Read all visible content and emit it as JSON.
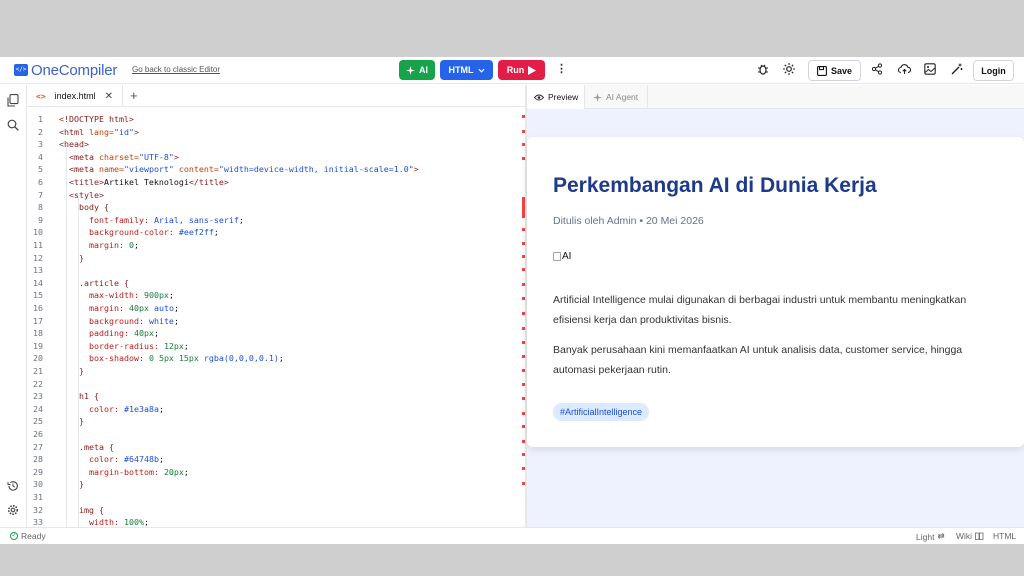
{
  "header": {
    "logo_text": "OneCompiler",
    "logo_mark": "</>",
    "back_link": "Go back to classic Editor",
    "ai_label": "AI",
    "lang_label": "HTML",
    "run_label": "Run",
    "save_label": "Save",
    "login_label": "Login",
    "icons": [
      "bug-icon",
      "sun-icon",
      "save-icon",
      "share-icon",
      "upload-icon",
      "image-icon",
      "magic-icon"
    ]
  },
  "editor": {
    "tab_name": "index.html",
    "lines": [
      {
        "n": "1",
        "i": 0,
        "t": [
          [
            "c-tag",
            "<!DOCTYPE html>"
          ]
        ]
      },
      {
        "n": "2",
        "i": 0,
        "t": [
          [
            "c-tag",
            "<html "
          ],
          [
            "c-attr",
            "lang="
          ],
          [
            "c-val",
            "\"id\""
          ],
          [
            "c-tag",
            ">"
          ]
        ]
      },
      {
        "n": "3",
        "i": 0,
        "t": [
          [
            "c-tag",
            "<head>"
          ]
        ]
      },
      {
        "n": "4",
        "i": 1,
        "t": [
          [
            "c-tag",
            "<meta "
          ],
          [
            "c-attr",
            "charset="
          ],
          [
            "c-val",
            "\"UTF-8\""
          ],
          [
            "c-tag",
            ">"
          ]
        ]
      },
      {
        "n": "5",
        "i": 1,
        "t": [
          [
            "c-tag",
            "<meta "
          ],
          [
            "c-attr",
            "name="
          ],
          [
            "c-val",
            "\"viewport\" "
          ],
          [
            "c-attr",
            "content="
          ],
          [
            "c-val",
            "\"width=device-width, initial-scale=1.0\""
          ],
          [
            "c-tag",
            ">"
          ]
        ]
      },
      {
        "n": "6",
        "i": 1,
        "t": [
          [
            "c-tag",
            "<title>"
          ],
          [
            "",
            "Artikel Teknologi"
          ],
          [
            "c-tag",
            "</title>"
          ]
        ]
      },
      {
        "n": "7",
        "i": 1,
        "t": [
          [
            "c-tag",
            "<style>"
          ]
        ]
      },
      {
        "n": "8",
        "i": 2,
        "t": [
          [
            "c-sel",
            "body {"
          ]
        ]
      },
      {
        "n": "9",
        "i": 3,
        "t": [
          [
            "c-prop",
            "font-family: "
          ],
          [
            "c-val",
            "Arial, sans-serif"
          ],
          [
            "",
            ";"
          ]
        ]
      },
      {
        "n": "10",
        "i": 3,
        "t": [
          [
            "c-prop",
            "background-color: "
          ],
          [
            "c-val",
            "#eef2ff"
          ],
          [
            "",
            ";"
          ]
        ]
      },
      {
        "n": "11",
        "i": 3,
        "t": [
          [
            "c-prop",
            "margin: "
          ],
          [
            "c-num",
            "0"
          ],
          [
            "",
            ";"
          ]
        ]
      },
      {
        "n": "12",
        "i": 2,
        "t": [
          [
            "c-sel",
            "}"
          ]
        ]
      },
      {
        "n": "13",
        "i": 0,
        "t": []
      },
      {
        "n": "14",
        "i": 2,
        "t": [
          [
            "c-sel",
            ".article {"
          ]
        ]
      },
      {
        "n": "15",
        "i": 3,
        "t": [
          [
            "c-prop",
            "max-width: "
          ],
          [
            "c-num",
            "900px"
          ],
          [
            "",
            ";"
          ]
        ]
      },
      {
        "n": "16",
        "i": 3,
        "t": [
          [
            "c-prop",
            "margin: "
          ],
          [
            "c-num",
            "40px "
          ],
          [
            "c-val",
            "auto"
          ],
          [
            "",
            ";"
          ]
        ]
      },
      {
        "n": "17",
        "i": 3,
        "t": [
          [
            "c-prop",
            "background: "
          ],
          [
            "c-val",
            "white"
          ],
          [
            "",
            ";"
          ]
        ]
      },
      {
        "n": "18",
        "i": 3,
        "t": [
          [
            "c-prop",
            "padding: "
          ],
          [
            "c-num",
            "40px"
          ],
          [
            "",
            ";"
          ]
        ]
      },
      {
        "n": "19",
        "i": 3,
        "t": [
          [
            "c-prop",
            "border-radius: "
          ],
          [
            "c-num",
            "12px"
          ],
          [
            "",
            ";"
          ]
        ]
      },
      {
        "n": "20",
        "i": 3,
        "t": [
          [
            "c-prop",
            "box-shadow: "
          ],
          [
            "c-num",
            "0 5px 15px "
          ],
          [
            "c-val",
            "rgba(0,0,0,0.1)"
          ],
          [
            "",
            ";"
          ]
        ]
      },
      {
        "n": "21",
        "i": 2,
        "t": [
          [
            "c-sel",
            "}"
          ]
        ]
      },
      {
        "n": "22",
        "i": 0,
        "t": []
      },
      {
        "n": "23",
        "i": 2,
        "t": [
          [
            "c-sel",
            "h1 {"
          ]
        ]
      },
      {
        "n": "24",
        "i": 3,
        "t": [
          [
            "c-prop",
            "color: "
          ],
          [
            "c-val",
            "#1e3a8a"
          ],
          [
            "",
            ";"
          ]
        ]
      },
      {
        "n": "25",
        "i": 2,
        "t": [
          [
            "c-sel",
            "}"
          ]
        ]
      },
      {
        "n": "26",
        "i": 0,
        "t": []
      },
      {
        "n": "27",
        "i": 2,
        "t": [
          [
            "c-sel",
            ".meta {"
          ]
        ]
      },
      {
        "n": "28",
        "i": 3,
        "t": [
          [
            "c-prop",
            "color: "
          ],
          [
            "c-val",
            "#64748b"
          ],
          [
            "",
            ";"
          ]
        ]
      },
      {
        "n": "29",
        "i": 3,
        "t": [
          [
            "c-prop",
            "margin-bottom: "
          ],
          [
            "c-num",
            "20px"
          ],
          [
            "",
            ";"
          ]
        ]
      },
      {
        "n": "30",
        "i": 2,
        "t": [
          [
            "c-sel",
            "}"
          ]
        ]
      },
      {
        "n": "31",
        "i": 0,
        "t": []
      },
      {
        "n": "32",
        "i": 2,
        "t": [
          [
            "c-sel",
            "img {"
          ]
        ]
      },
      {
        "n": "33",
        "i": 3,
        "t": [
          [
            "c-prop",
            "width: "
          ],
          [
            "c-num",
            "100%"
          ],
          [
            "",
            ";"
          ]
        ]
      }
    ]
  },
  "preview": {
    "tab_preview": "Preview",
    "tab_agent": "AI Agent",
    "title": "Perkembangan AI di Dunia Kerja",
    "meta": "Ditulis oleh Admin • 20 Mei 2026",
    "img_alt": "AI",
    "p1": "Artificial Intelligence mulai digunakan di berbagai industri untuk membantu meningkatkan efisiensi kerja dan produktivitas bisnis.",
    "p2": "Banyak perusahaan kini memanfaatkan AI untuk analisis data, customer service, hingga automasi pekerjaan rutin.",
    "tag": "#ArtificialIntelligence"
  },
  "status": {
    "ready": "Ready",
    "theme": "Light",
    "wiki": "Wiki",
    "lang": "HTML"
  }
}
